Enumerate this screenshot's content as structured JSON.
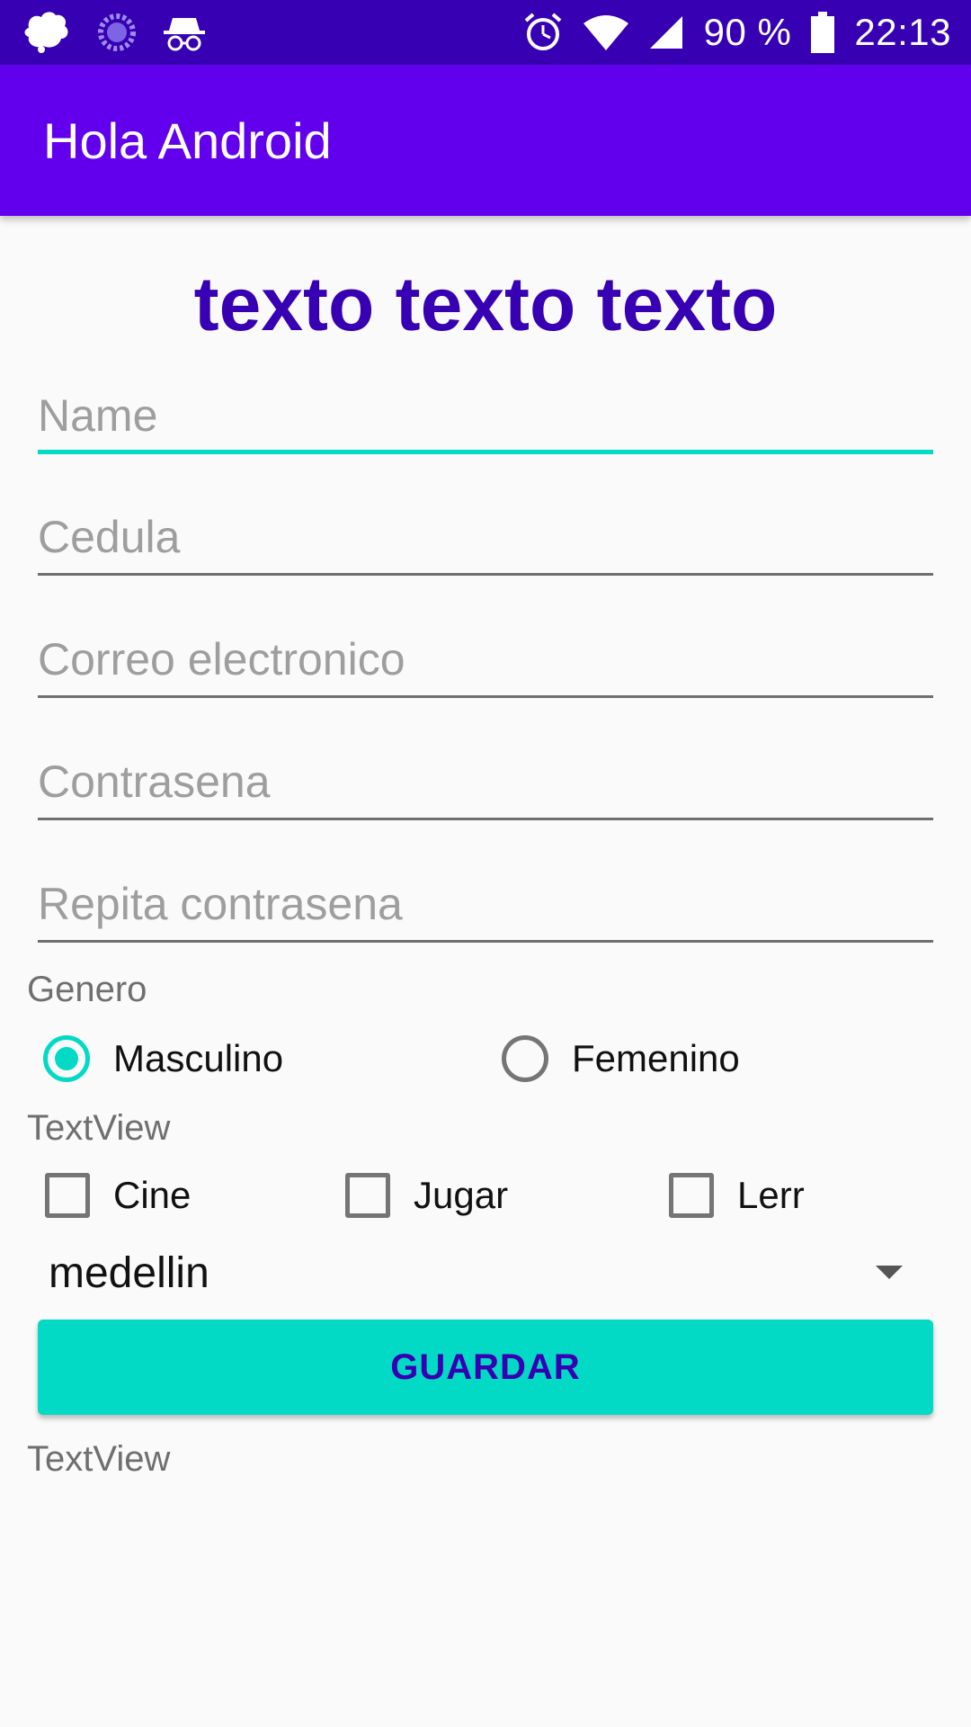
{
  "status_bar": {
    "battery": "90 %",
    "time": "22:13",
    "left_icons": [
      "bird-icon",
      "loading-circle-icon",
      "incognito-icon"
    ],
    "right_icons": [
      "alarm-icon",
      "wifi-icon",
      "signal-icon",
      "battery-icon"
    ]
  },
  "app_bar": {
    "title": "Hola Android"
  },
  "header": {
    "text": "texto texto texto"
  },
  "form": {
    "name_placeholder": "Name",
    "cedula_placeholder": "Cedula",
    "email_placeholder": "Correo electronico",
    "password_placeholder": "Contrasena",
    "repeat_password_placeholder": "Repita contrasena"
  },
  "gender": {
    "label": "Genero",
    "options": [
      "Masculino",
      "Femenino"
    ],
    "selected": "Masculino"
  },
  "textview_top": "TextView",
  "interests": {
    "options": [
      "Cine",
      "Jugar",
      "Lerr"
    ]
  },
  "spinner": {
    "selected": "medellin"
  },
  "save_button": {
    "label": "GUARDAR"
  },
  "textview_bottom": "TextView",
  "colors": {
    "status_bar": "#3700b3",
    "app_bar": "#6200ee",
    "accent": "#03dac5",
    "primary_text": "#3700b3"
  }
}
